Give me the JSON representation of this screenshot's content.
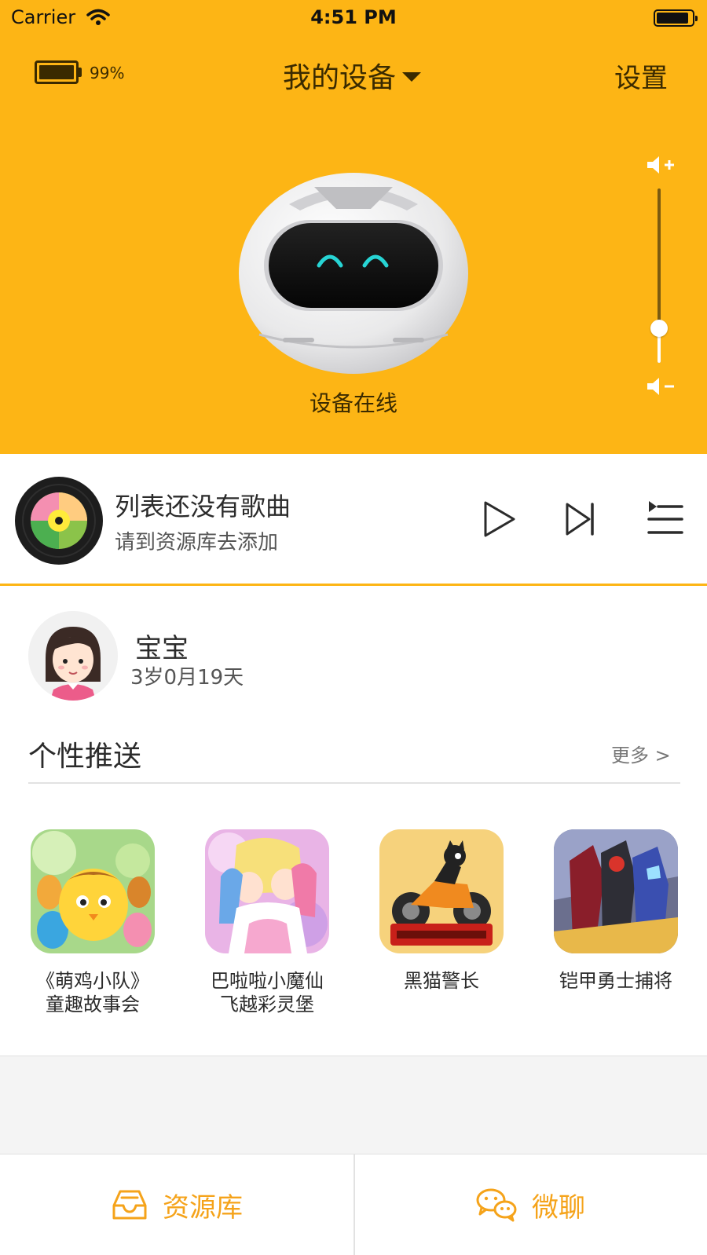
{
  "status_bar": {
    "carrier": "Carrier",
    "time": "4:51 PM"
  },
  "header": {
    "battery_percent_text": "99%",
    "battery_level": 0.99,
    "title": "我的设备",
    "settings_label": "设置"
  },
  "device": {
    "status": "设备在线",
    "volume_level": 0.2
  },
  "player": {
    "title": "列表还没有歌曲",
    "subtitle": "请到资源库去添加",
    "icons": [
      "play-icon",
      "next-track-icon",
      "playlist-icon"
    ]
  },
  "profile": {
    "name": "宝宝",
    "age": "3岁0月19天"
  },
  "recommend": {
    "title": "个性推送",
    "more_label": "更多 >",
    "items": [
      {
        "label": "《萌鸡小队》\n童趣故事会"
      },
      {
        "label": "巴啦啦小魔仙\n飞越彩灵堡"
      },
      {
        "label": "黑猫警长"
      },
      {
        "label": "铠甲勇士捕将"
      }
    ]
  },
  "tabs": [
    {
      "label": "资源库",
      "icon": "inbox-tray-icon"
    },
    {
      "label": "微聊",
      "icon": "wechat-chat-icon"
    }
  ],
  "colors": {
    "accent": "#fdb515",
    "tab_text": "#f5a31a",
    "dark_brown": "#3a2a00"
  }
}
